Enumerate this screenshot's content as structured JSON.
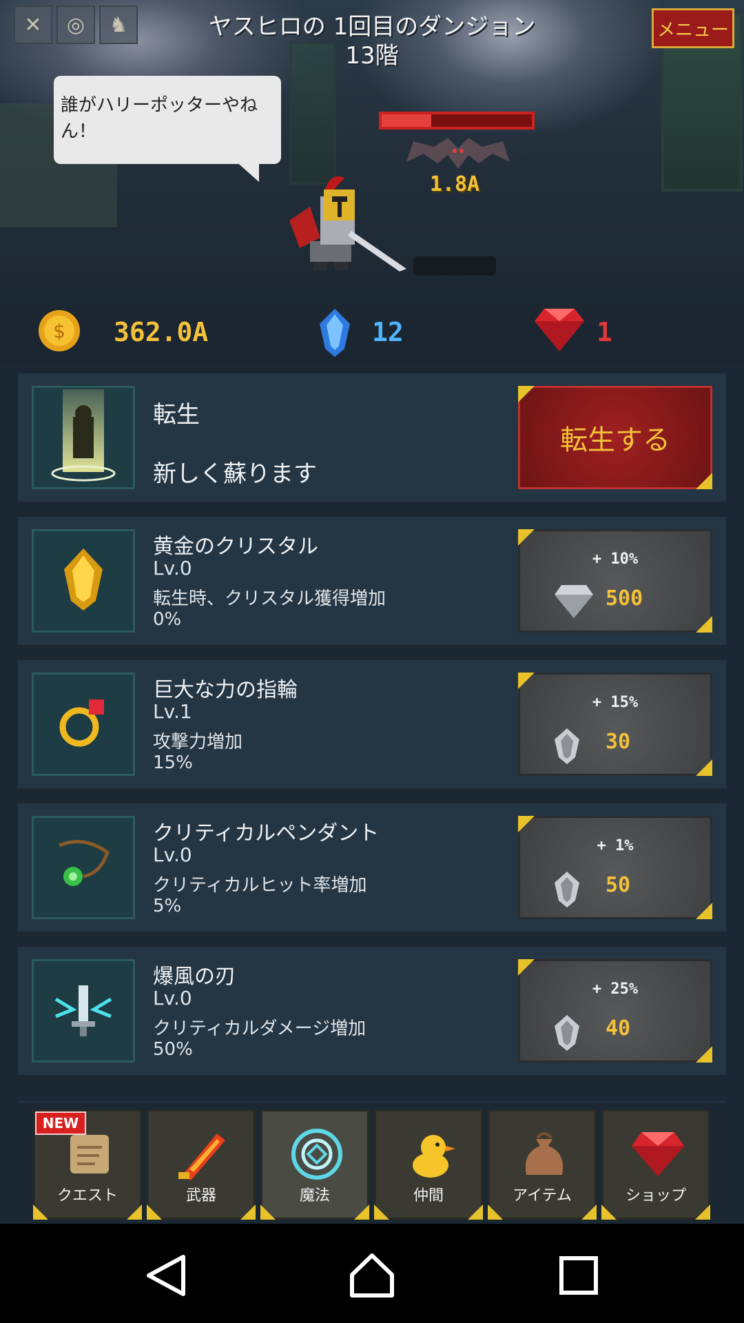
{
  "header": {
    "dungeon_title": "ヤスヒロの 1回目のダンジョン",
    "floor": "13階",
    "menu_label": "メニュー",
    "top_icons": [
      "crossed-swords-icon",
      "coin-stack-icon",
      "boot-icon"
    ]
  },
  "speech_bubble": "誰がハリーポッターやねん！",
  "enemy": {
    "hp_fraction": 0.33,
    "value": "1.8A",
    "name": "bat"
  },
  "currency": {
    "gold": "362.0A",
    "crystal": "12",
    "ruby": "1"
  },
  "rebirth": {
    "title": "転生",
    "subtitle": "新しく蘇ります",
    "button_label": "転生する"
  },
  "upgrades": [
    {
      "name": "黄金のクリスタル",
      "level": "Lv.0",
      "description": "転生時、クリスタル獲得増加",
      "value": "0%",
      "bonus": "+ 10%",
      "cost": "500",
      "cost_icon": "diamond-icon",
      "item_icon": "gold-crystal-icon"
    },
    {
      "name": "巨大な力の指輪",
      "level": "Lv.1",
      "description": "攻撃力増加",
      "value": "15%",
      "bonus": "+ 15%",
      "cost": "30",
      "cost_icon": "crystal-icon",
      "item_icon": "ring-icon"
    },
    {
      "name": "クリティカルペンダント",
      "level": "Lv.0",
      "description": "クリティカルヒット率増加",
      "value": "5%",
      "bonus": "+ 1%",
      "cost": "50",
      "cost_icon": "crystal-icon",
      "item_icon": "pendant-icon"
    },
    {
      "name": "爆風の刃",
      "level": "Lv.0",
      "description": "クリティカルダメージ増加",
      "value": "50%",
      "bonus": "+ 25%",
      "cost": "40",
      "cost_icon": "crystal-icon",
      "item_icon": "wind-blade-icon"
    }
  ],
  "tabs": [
    {
      "label": "クエスト",
      "icon": "scroll-icon",
      "badge": "NEW",
      "active": false
    },
    {
      "label": "武器",
      "icon": "flame-sword-icon",
      "active": false
    },
    {
      "label": "魔法",
      "icon": "magic-circle-icon",
      "active": true
    },
    {
      "label": "仲間",
      "icon": "chick-icon",
      "active": false
    },
    {
      "label": "アイテム",
      "icon": "bag-icon",
      "active": false
    },
    {
      "label": "ショップ",
      "icon": "ruby-icon",
      "active": false
    }
  ],
  "colors": {
    "panel_bg": "#1b2834",
    "row_bg": "#243544",
    "gold_text": "#f3c13a",
    "crystal_text": "#4fb4ff",
    "ruby_text": "#e0383a",
    "rebirth_button": "#8e1b1b",
    "corner_accent": "#e8c22a"
  }
}
